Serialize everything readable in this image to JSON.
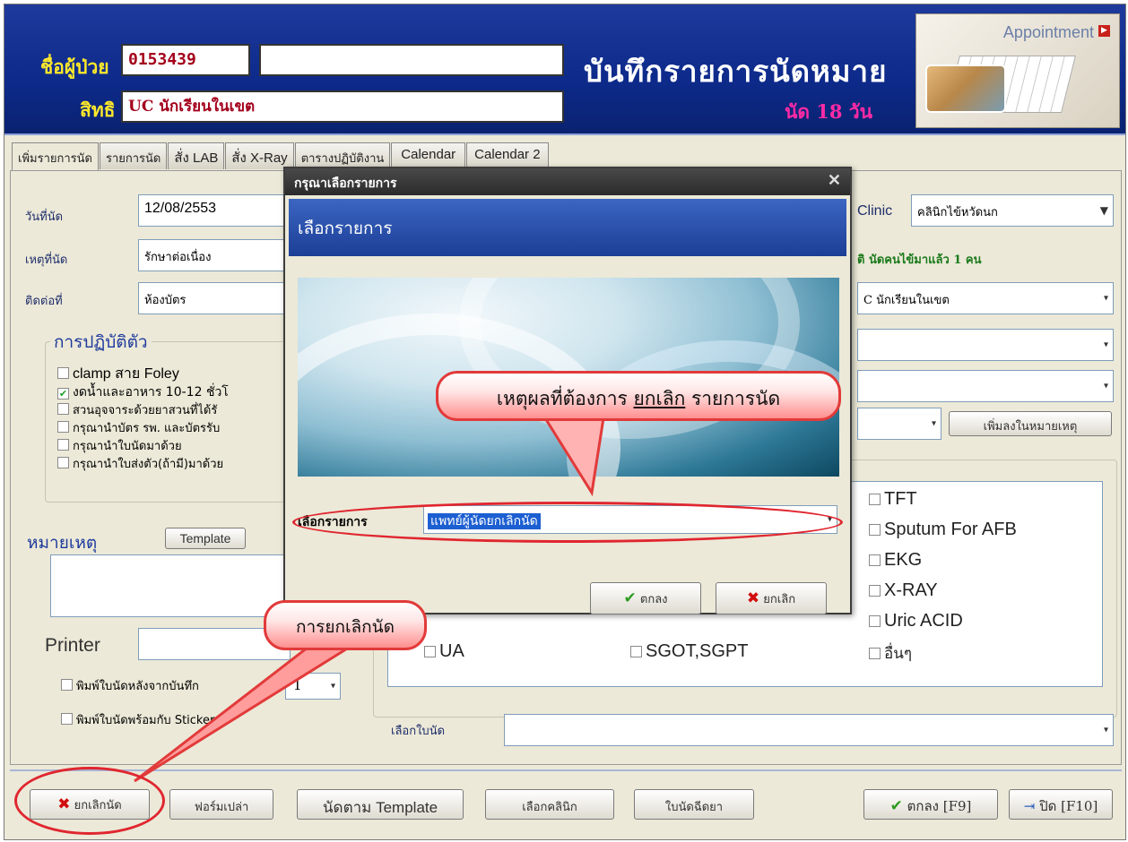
{
  "header": {
    "patient_label": "ชื่อผู้ป่วย",
    "patient_id": "0153439",
    "patient_name": "",
    "right_label": "สิทธิ",
    "right_value": "UC นักเรียนในเขต",
    "title": "บันทึกรายการนัดหมาย",
    "subtitle": "นัด 18 วัน",
    "appointment_label": "Appointment"
  },
  "tabs": [
    {
      "label": "เพิ่มรายการนัด"
    },
    {
      "label": "รายการนัด"
    },
    {
      "label": "สั่ง LAB"
    },
    {
      "label": "สั่ง X-Ray"
    },
    {
      "label": "ตารางปฏิบัติงาน"
    },
    {
      "label": "Calendar"
    },
    {
      "label": "Calendar 2"
    }
  ],
  "form": {
    "date_label": "วันที่นัด",
    "date_value": "12/08/2553",
    "reason_label": "เหตุที่นัด",
    "reason_value": "รักษาต่อเนื่อง",
    "contact_label": "ติดต่อที่",
    "contact_value": "ห้องบัตร",
    "clinic_label": "Clinic",
    "clinic_value": "คลินิกไข้หวัดนก",
    "status_text": "ติ นัดคนไข้มาแล้ว 1 คน",
    "right_value": "C นักเรียนในเขต",
    "add_note_button": "เพิ่มลงในหมายเหตุ",
    "practice_title": "การปฏิบัติตัว",
    "practices": [
      {
        "label": "clamp สาย Foley",
        "checked": false
      },
      {
        "label": "งดน้ำและอาหาร 10-12 ชั่วโ",
        "checked": true
      },
      {
        "label": "สวนอุจจาระด้วยยาสวนที่ได้รั",
        "checked": false
      },
      {
        "label": "กรุณานำบัตร รพ. และบัตรรับ",
        "checked": false
      },
      {
        "label": "กรุณานำใบนัดมาด้วย",
        "checked": false
      },
      {
        "label": "กรุณานำใบส่งตัว(ถ้ามี)มาด้วย",
        "checked": false
      }
    ],
    "note_label": "หมายเหตุ",
    "template_button": "Template",
    "printer_label": "Printer",
    "print_after_save": "พิมพ์ใบนัดหลังจากบันทึก",
    "print_copies": "1",
    "print_with_sticker": "พิมพ์ใบนัดพร้อมกับ Sticker ย",
    "select_slip_label": "เลือกใบนัด",
    "labs": [
      {
        "label": "TFT"
      },
      {
        "label": "Sputum For AFB"
      },
      {
        "label": "EKG"
      },
      {
        "label": "X-RAY"
      },
      {
        "label": "Uric ACID"
      },
      {
        "label": "อื่นๆ"
      },
      {
        "label": "SGOT,SGPT"
      },
      {
        "label": "UA"
      }
    ]
  },
  "bottom": {
    "cancel_appt": "ยกเลิกนัด",
    "blank_form": "ฟอร์มเปล่า",
    "by_template": "นัดตาม Template",
    "choose_clinic": "เลือกคลินิก",
    "injection_slip": "ใบนัดฉีดยา",
    "ok_f9": "ตกลง [F9]",
    "close_f10": "ปิด [F10]"
  },
  "dialog": {
    "titlebar": "กรุณาเลือกรายการ",
    "heading": "เลือกรายการ",
    "select_label": "เลือกรายการ",
    "select_value": "แพทย์ผู้นัดยกเลิกนัด",
    "ok_button": "ตกลง",
    "cancel_button": "ยกเลิก"
  },
  "annotations": {
    "callout_reason_pre": "เหตุผลที่ต้องการ ",
    "callout_reason_u": "ยกเลิก",
    "callout_reason_post": " รายการนัด",
    "callout_cancel": "การยกเลิกนัด"
  },
  "colors": {
    "header_bg": "#0d2a8a",
    "header_label": "#ffe92b",
    "accent_pink": "#ff2aa5",
    "callout_border": "#e23a3a"
  }
}
